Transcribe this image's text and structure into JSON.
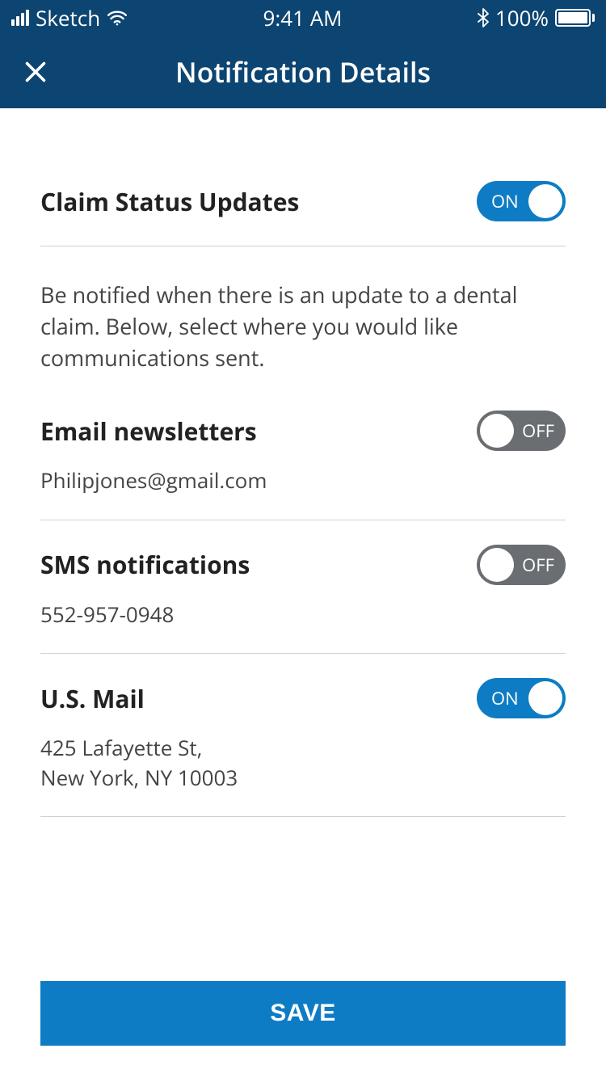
{
  "status_bar": {
    "carrier": "Sketch",
    "time": "9:41 AM",
    "battery_pct": "100%"
  },
  "header": {
    "title": "Notification Details"
  },
  "main_toggle": {
    "title": "Claim Status Updates",
    "state_label": "ON",
    "on": true
  },
  "description": "Be notified when there is an update to a dental claim. Below, select where you would like communications sent.",
  "channels": [
    {
      "title": "Email newsletters",
      "value": "Philipjones@gmail.com",
      "state_label": "OFF",
      "on": false
    },
    {
      "title": "SMS notifications",
      "value": "552-957-0948",
      "state_label": "OFF",
      "on": false
    },
    {
      "title": "U.S. Mail",
      "value": "425 Lafayette St,\nNew York, NY 10003",
      "state_label": "ON",
      "on": true
    }
  ],
  "footer": {
    "save_label": "SAVE"
  },
  "colors": {
    "header_bg": "#0d4572",
    "accent": "#0e7cc4",
    "toggle_off": "#6a6e72"
  }
}
